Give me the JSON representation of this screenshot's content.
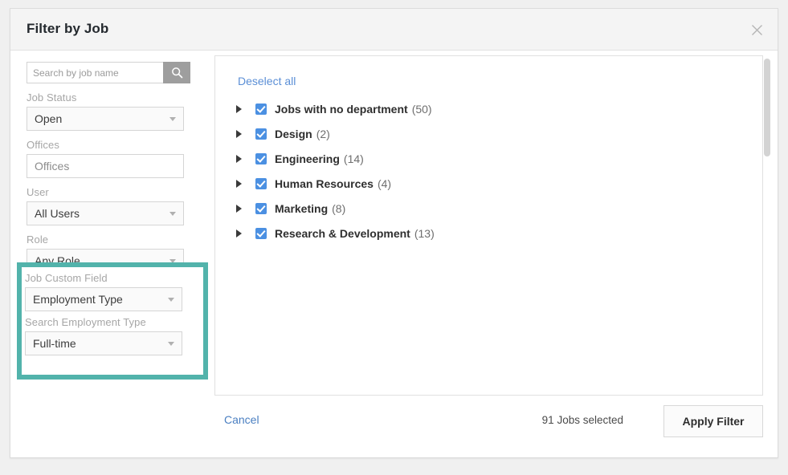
{
  "modal": {
    "title": "Filter by Job",
    "close_icon": "close-icon"
  },
  "sidebar": {
    "search": {
      "placeholder": "Search by job name",
      "value": "",
      "icon": "search-icon"
    },
    "fields": [
      {
        "label": "Job Status",
        "value": "Open",
        "type": "select"
      },
      {
        "label": "Offices",
        "value": "Offices",
        "type": "input"
      },
      {
        "label": "User",
        "value": "All Users",
        "type": "select"
      },
      {
        "label": "Role",
        "value": "Any Role",
        "type": "select"
      }
    ],
    "highlighted": {
      "border_color": "#52b3ab",
      "fields": [
        {
          "label": "Job Custom Field",
          "value": "Employment Type",
          "type": "select"
        },
        {
          "label": "Search Employment Type",
          "value": "Full-time",
          "type": "select"
        }
      ]
    }
  },
  "tree": {
    "deselect_all_label": "Deselect all",
    "items": [
      {
        "name": "Jobs with no department",
        "count": "(50)",
        "checked": true,
        "expanded": false
      },
      {
        "name": "Design",
        "count": "(2)",
        "checked": true,
        "expanded": false
      },
      {
        "name": "Engineering",
        "count": "(14)",
        "checked": true,
        "expanded": false
      },
      {
        "name": "Human Resources",
        "count": "(4)",
        "checked": true,
        "expanded": false
      },
      {
        "name": "Marketing",
        "count": "(8)",
        "checked": true,
        "expanded": false
      },
      {
        "name": "Research & Development",
        "count": "(13)",
        "checked": true,
        "expanded": false
      }
    ]
  },
  "footer": {
    "cancel_label": "Cancel",
    "selected_status": "91 Jobs selected",
    "apply_label": "Apply Filter"
  },
  "colors": {
    "accent_blue": "#4b90e2",
    "link_blue": "#5b8fd6",
    "highlight_teal": "#52b3ab",
    "header_bg": "#f4f4f4"
  }
}
